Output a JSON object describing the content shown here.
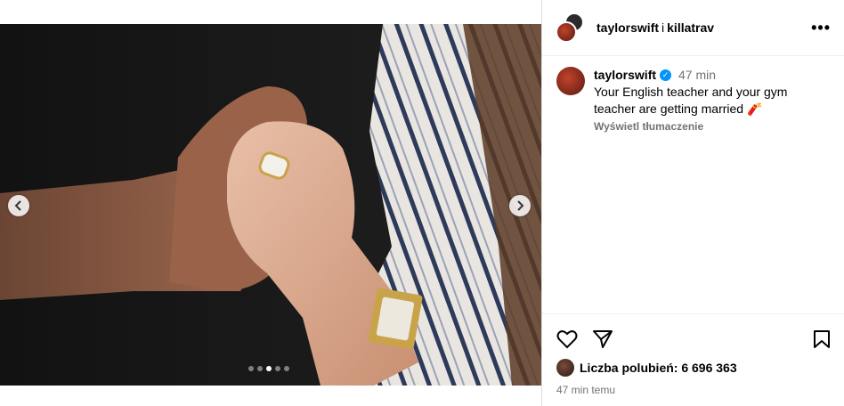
{
  "post": {
    "collab_label": {
      "user1": "taylorswift",
      "separator": "i",
      "user2": "killatrav"
    },
    "more_label": "•••",
    "caption": {
      "username": "taylorswift",
      "time": "47 min",
      "text": "Your English teacher and your gym teacher are getting married 🧨",
      "translate_label": "Wyświetl tłumaczenie"
    },
    "likes_label": "Liczba polubień: 6 696 363",
    "posted_ago": "47 min temu"
  },
  "carousel": {
    "slide_count": 5,
    "active_index": 2,
    "prev_icon": "chevron-left-icon",
    "next_icon": "chevron-right-icon"
  },
  "icons": {
    "like": "heart-icon",
    "share": "send-icon",
    "save": "bookmark-icon",
    "verified": "verified-badge-icon"
  },
  "colors": {
    "verified": "#0095f6",
    "muted_text": "#737373",
    "border": "#dbdbdb"
  }
}
